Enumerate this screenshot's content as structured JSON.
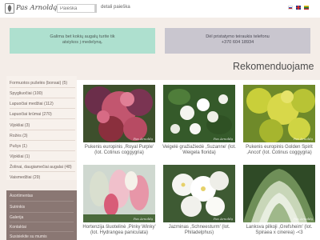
{
  "header": {
    "brand": "Pas Arnoldą",
    "search_placeholder": "Paieška",
    "detail_link": "detali paieška",
    "languages": [
      "ru",
      "en",
      "lt"
    ]
  },
  "notices": {
    "green": [
      "Galima bet kokių augalų turite tik",
      "atsiykos į medelyną."
    ],
    "gray": [
      "Dėl pristatymo teiraukis telefonu",
      "+370 604 18934"
    ]
  },
  "section_title": "Rekomenduojame",
  "categories": [
    "Formuotos pušelės (bonsai) (5)",
    "Spygliuočiai (100)",
    "Lapuočiai medžiai (112)",
    "Lapuočiai krūmai (270)",
    "Vijokliai (3)",
    "Rožės (3)",
    "Pušys (1)",
    "Vijokliai (1)",
    "Žolinai, daugiamečiai augalai (48)",
    "Vaismedžiai (29)"
  ],
  "menu": [
    "Asortimentas",
    "Sutrinkis",
    "Galerija",
    "Kontaktai",
    "Susisiekite su mumis"
  ],
  "products": [
    {
      "caption": "Pukenis europinis ,Royal Purple' (lot. Cotinus coggygria)",
      "image": "purple-smoke-bush"
    },
    {
      "caption": "Veigelė gražiažiedė ,Suzanne' (lot. Weigela florida)",
      "image": "white-weigela"
    },
    {
      "caption": "Pukenis europinis Golden Spirit ,Ancot' (lot. Cotinus coggygria)",
      "image": "golden-smoke-bush"
    },
    {
      "caption": "Hortenzija šluotelinė ,Pinky Winky' (lot. Hydrangea paniculata)",
      "image": "pink-hydrangea"
    },
    {
      "caption": "Jazminas ,Schneesturm' (lot. Philadelphus)",
      "image": "white-philadelphus"
    },
    {
      "caption": "Lanksva pilkoji ,Grefsheim' (lot. Spiraea x cinerea) -<3",
      "image": "spiraea-grass"
    }
  ],
  "watermark": "Pas Arnoldą",
  "colors": {
    "band": "#f4ede8",
    "green_notice": "#aee0cf",
    "gray_notice": "#c9c6cf",
    "menu_panel": "#8a7773"
  }
}
